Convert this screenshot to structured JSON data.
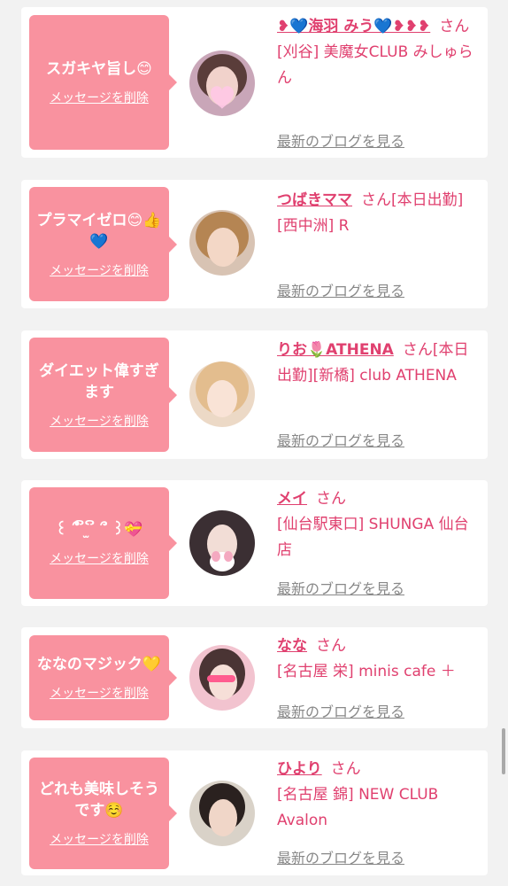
{
  "entries": [
    {
      "message": "スガキヤ旨し😊",
      "delete_label": "メッセージを削除",
      "name": "❥💙海羽 みう💙❥❥❥",
      "honorific": "さん",
      "shop": "[刈谷] 美魔女CLUB みしゅらん",
      "blog_label": "最新のブログを見る"
    },
    {
      "message": "プラマイゼロ😊👍💙",
      "delete_label": "メッセージを削除",
      "name": "つばきママ",
      "honorific": "さん",
      "shop": "[本日出勤][西中洲] R",
      "blog_label": "最新のブログを見る"
    },
    {
      "message": "ダイエット偉すぎます",
      "delete_label": "メッセージを削除",
      "name": "りお🌷ATHENA",
      "honorific": "さん",
      "shop": "[本日出勤][新橋] club ATHENA",
      "blog_label": "最新のブログを見る"
    },
    {
      "message": "꒰ ՞ ິ ̫ ິ ՞ ꒱💝",
      "delete_label": "メッセージを削除",
      "name": "メイ",
      "honorific": "さん",
      "shop": "[仙台駅東口] SHUNGA 仙台店",
      "blog_label": "最新のブログを見る"
    },
    {
      "message": "ななのマジック💛",
      "delete_label": "メッセージを削除",
      "name": "なな",
      "honorific": "さん",
      "shop": "[名古屋 栄] minis cafe ＋",
      "blog_label": "最新のブログを見る"
    },
    {
      "message": "どれも美味しそうです☺️",
      "delete_label": "メッセージを削除",
      "name": "ひより",
      "honorific": "さん",
      "shop": "[名古屋 錦] NEW CLUB Avalon",
      "blog_label": "最新のブログを見る"
    }
  ],
  "colors": {
    "bubble": "#f9929f",
    "accent": "#e0406f",
    "link_gray": "#888888",
    "background": "#f2f2f2"
  }
}
